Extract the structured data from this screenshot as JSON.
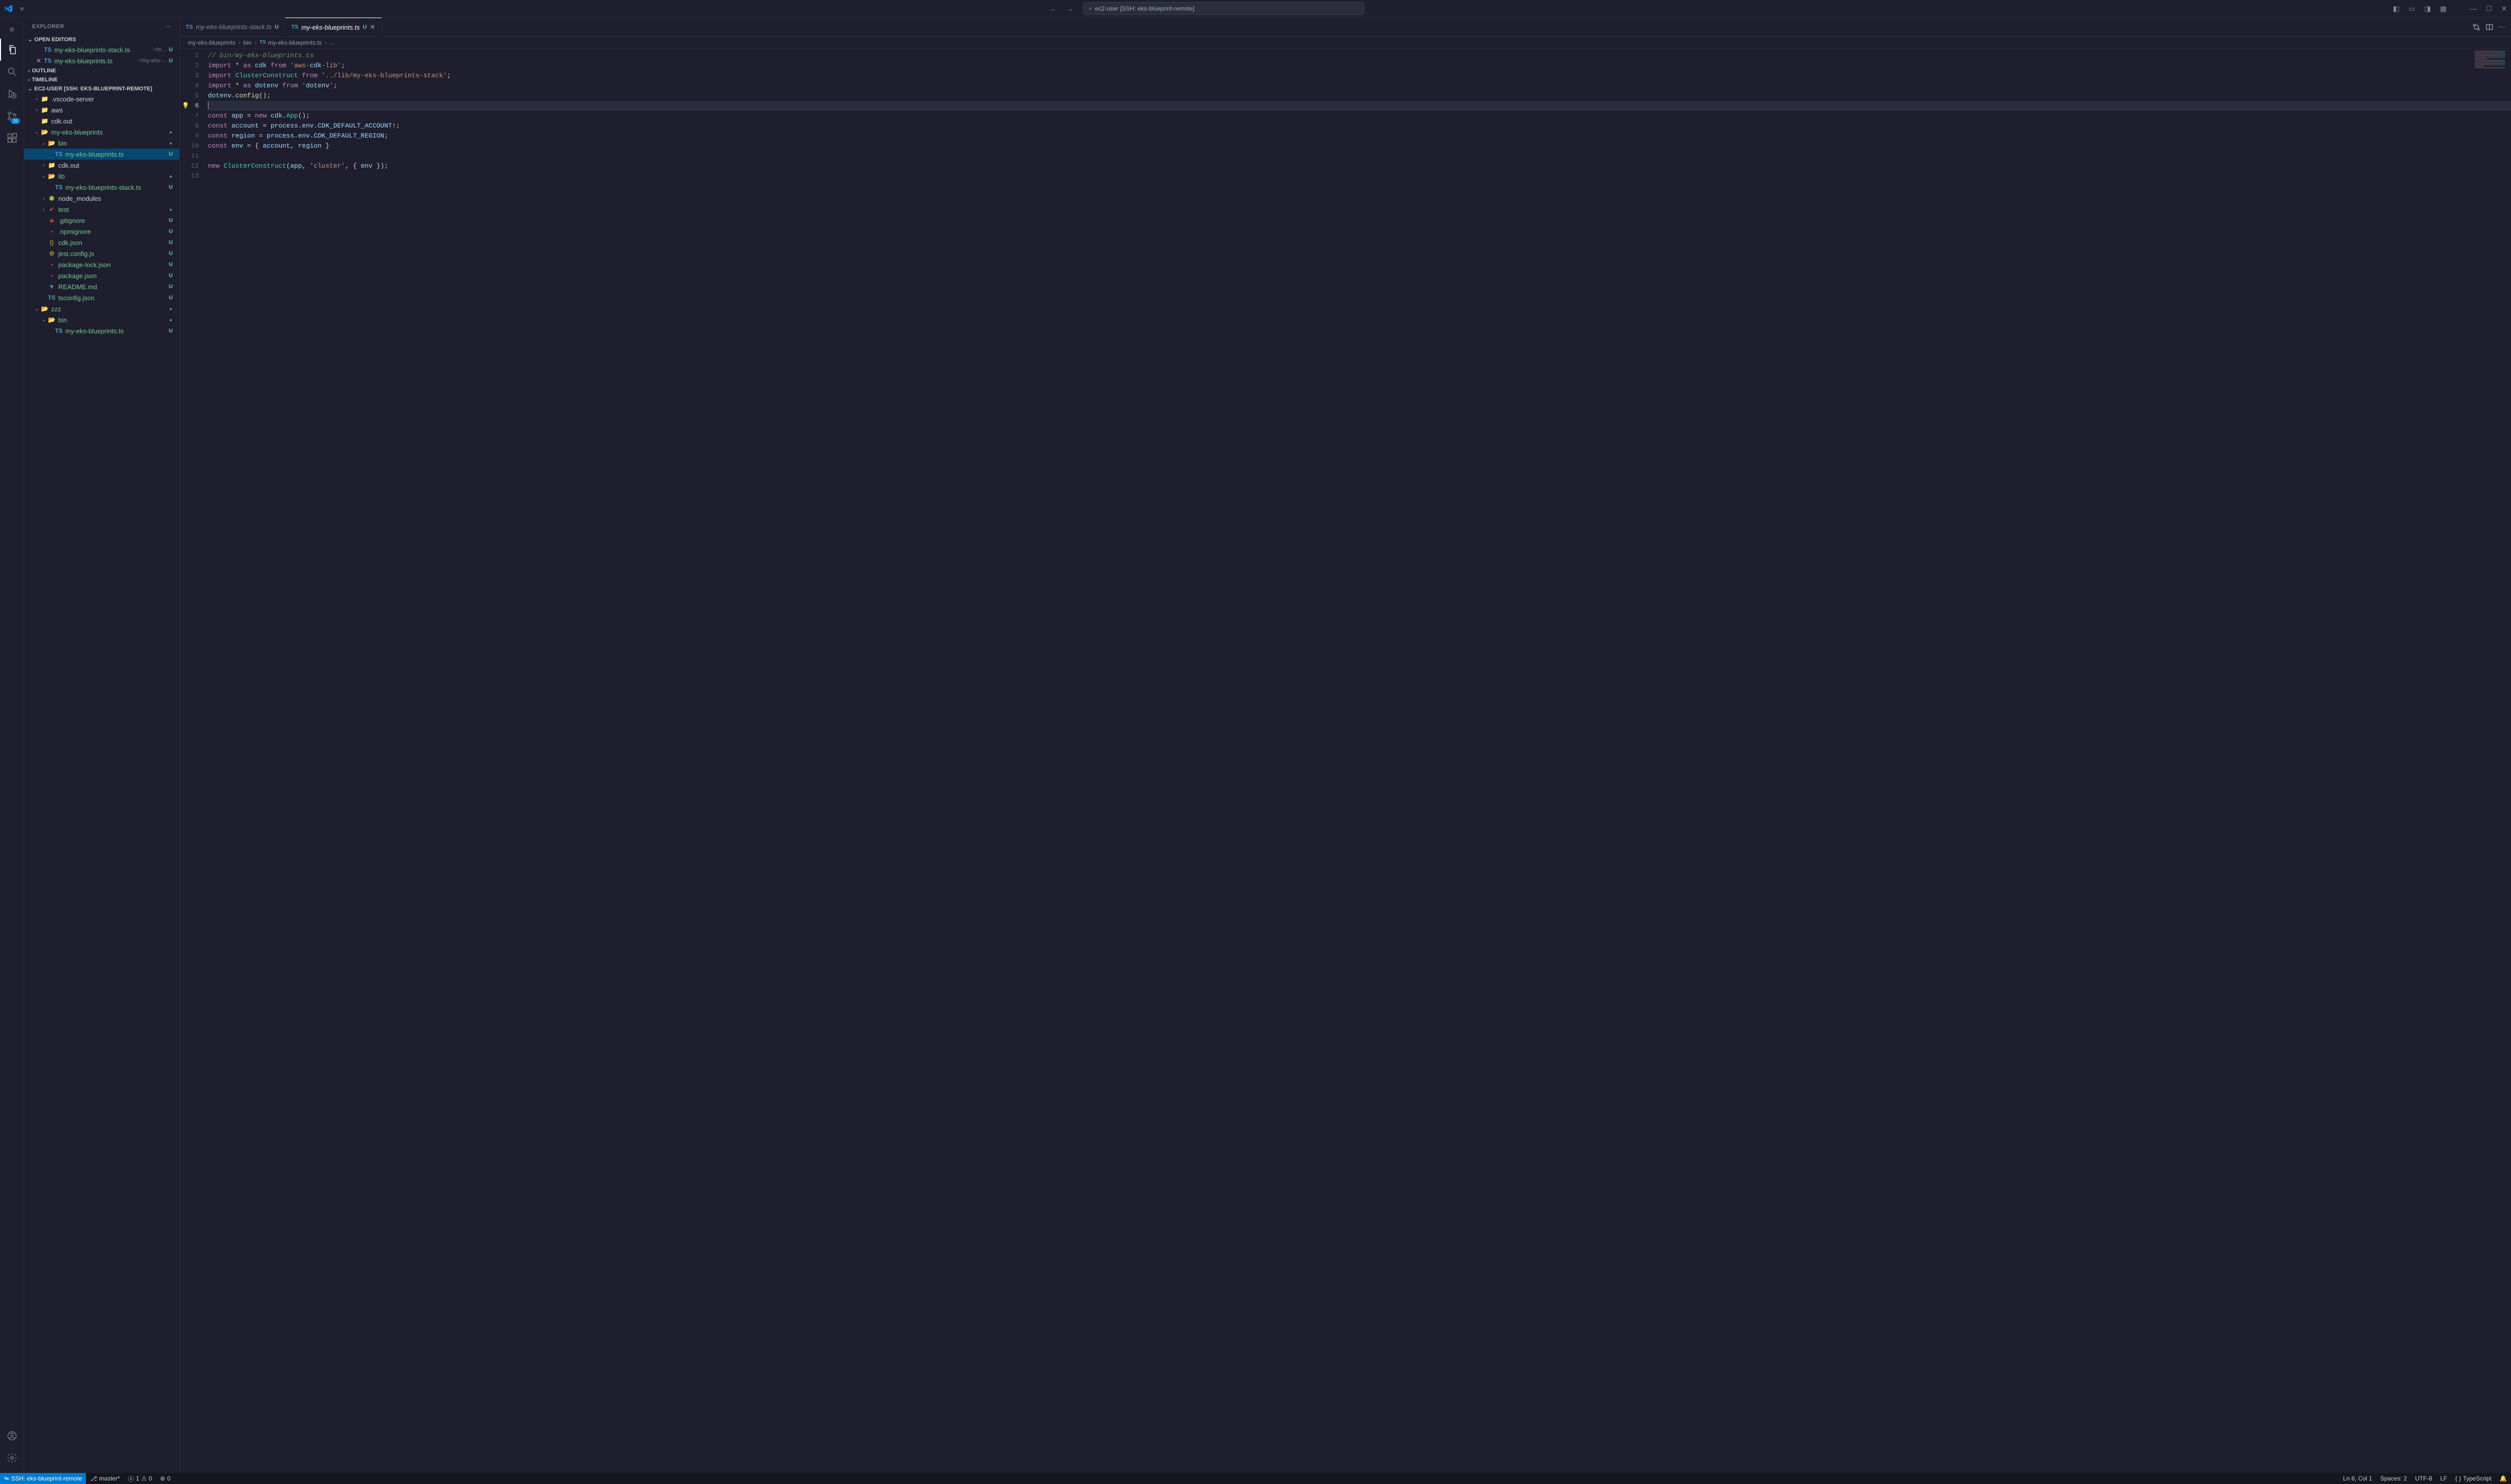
{
  "title": {
    "search_text": "ec2-user [SSH: eks-blueprint-remote]"
  },
  "activitybar": {
    "scm_badge": "25"
  },
  "sidebar": {
    "title": "EXPLORER",
    "sections": {
      "open_editors": "OPEN EDITORS",
      "outline": "OUTLINE",
      "timeline": "TIMELINE",
      "workspace": "EC2-USER [SSH: EKS-BLUEPRINT-REMOTE]"
    },
    "open_editors": [
      {
        "name": "my-eks-blueprints-stack.ts",
        "desc": "~/m...",
        "status": "U"
      },
      {
        "name": "my-eks-blueprints.ts",
        "desc": "~/my-eks-...",
        "status": "U",
        "close": true
      }
    ],
    "tree": {
      "vscode_server": ".vscode-server",
      "aws": "aws",
      "cdk_out": "cdk.out",
      "my_eks": "my-eks-blueprints",
      "bin": "bin",
      "file_bin": "my-eks-blueprints.ts",
      "cdk_out2": "cdk.out",
      "lib": "lib",
      "file_lib": "my-eks-blueprints-stack.ts",
      "node_modules": "node_modules",
      "test": "test",
      "gitignore": ".gitignore",
      "npmignore": ".npmignore",
      "cdk_json": "cdk.json",
      "jest": "jest.config.js",
      "pkg_lock": "package-lock.json",
      "pkg": "package.json",
      "readme": "README.md",
      "tsconfig": "tsconfig.json",
      "zzz": "zzz",
      "zzz_bin": "bin",
      "zzz_file": "my-eks-blueprints.ts"
    }
  },
  "tabs": [
    {
      "name": "my-eks-blueprints-stack.ts",
      "status": "U",
      "active": false
    },
    {
      "name": "my-eks-blueprints.ts",
      "status": "U",
      "active": true
    }
  ],
  "breadcrumbs": {
    "p0": "my-eks-blueprints",
    "p1": "bin",
    "p2": "my-eks-blueprints.ts",
    "p3": "..."
  },
  "code": {
    "lines": [
      "// bin/my-eks-blueprints.ts",
      "import * as cdk from 'aws-cdk-lib';",
      "import ClusterConstruct from '../lib/my-eks-blueprints-stack';",
      "import * as dotenv from 'dotenv';",
      "dotenv.config();",
      "",
      "const app = new cdk.App();",
      "const account = process.env.CDK_DEFAULT_ACCOUNT!;",
      "const region = process.env.CDK_DEFAULT_REGION;",
      "const env = { account, region }",
      "",
      "new ClusterConstruct(app, 'cluster', { env });",
      ""
    ],
    "current_line": 6,
    "bulb_line": 6
  },
  "statusbar": {
    "remote": "SSH: eks-blueprint-remote",
    "branch": "master*",
    "errors": "1",
    "warnings": "0",
    "port": "0",
    "ln_col": "Ln 6, Col 1",
    "spaces": "Spaces: 2",
    "encoding": "UTF-8",
    "eol": "LF",
    "lang": "TypeScript"
  }
}
